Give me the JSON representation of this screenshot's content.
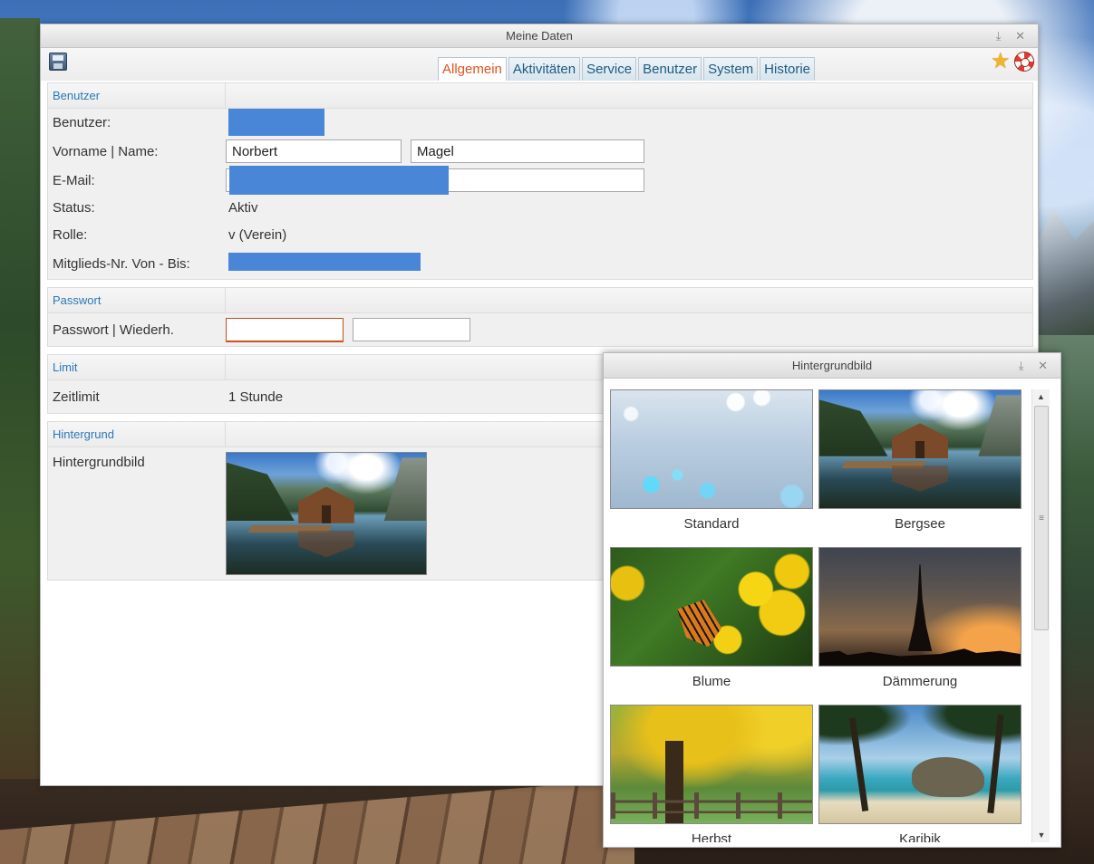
{
  "main_window": {
    "title": "Meine Daten",
    "controls": "⤓ ✕",
    "tabs": [
      {
        "label": "Allgemein",
        "active": true
      },
      {
        "label": "Aktivitäten",
        "active": false
      },
      {
        "label": "Service",
        "active": false
      },
      {
        "label": "Benutzer",
        "active": false
      },
      {
        "label": "System",
        "active": false
      },
      {
        "label": "Historie",
        "active": false
      }
    ]
  },
  "sections": {
    "benutzer": {
      "heading": "Benutzer",
      "user_label": "Benutzer:",
      "name_label": "Vorname | Name:",
      "first_name": "Norbert",
      "last_name": "Magel",
      "email_label": "E-Mail:",
      "status_label": "Status:",
      "status_value": "Aktiv",
      "role_label": "Rolle:",
      "role_value": "v (Verein)",
      "member_label": "Mitglieds-Nr. Von - Bis:"
    },
    "passwort": {
      "heading": "Passwort",
      "label": "Passwort | Wiederh."
    },
    "limit": {
      "heading": "Limit",
      "label": "Zeitlimit",
      "value": "1 Stunde"
    },
    "hintergrund": {
      "heading": "Hintergrund",
      "label": "Hintergrundbild"
    }
  },
  "popup": {
    "title": "Hintergrundbild",
    "controls": "⤓ ✕",
    "items": [
      {
        "caption": "Standard"
      },
      {
        "caption": "Bergsee"
      },
      {
        "caption": "Blume"
      },
      {
        "caption": "Dämmerung"
      },
      {
        "caption": "Herbst"
      },
      {
        "caption": "Karibik"
      }
    ]
  },
  "icons": {
    "save": "save-icon",
    "favorite": "star-icon",
    "help": "lifebuoy-icon"
  },
  "colors": {
    "active_tab": "#e0521c",
    "tab_text": "#1d5a80",
    "section_heading": "#2a78b8",
    "redaction": "#4a86d8"
  }
}
